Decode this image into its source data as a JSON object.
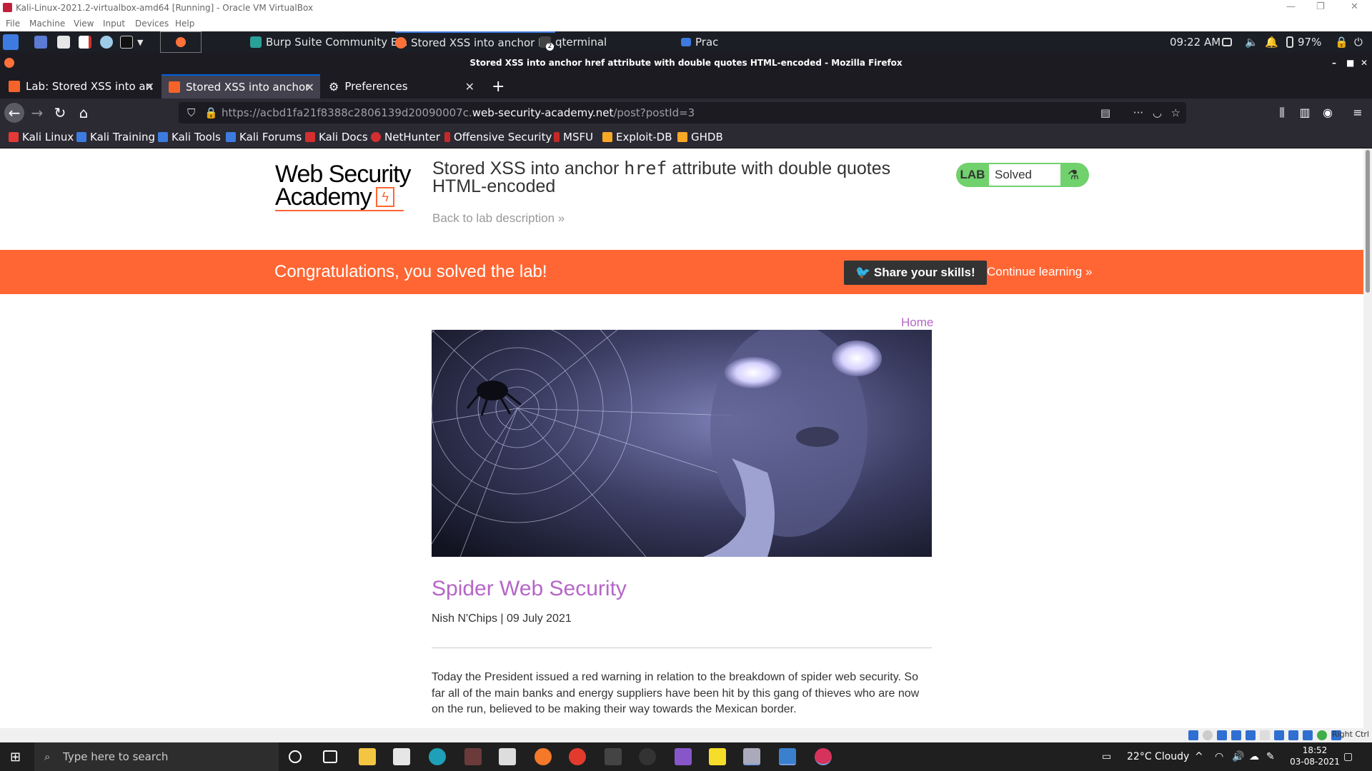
{
  "vbox": {
    "title": "Kali-Linux-2021.2-virtualbox-amd64 [Running] - Oracle VM VirtualBox",
    "menu": [
      "File",
      "Machine",
      "View",
      "Input",
      "Devices",
      "Help"
    ],
    "status_right": "Right Ctrl"
  },
  "kali_panel": {
    "tasks": [
      {
        "label": "Burp Suite Community E...",
        "color": "#2aa198"
      },
      {
        "label": "Stored XSS into anchor h...",
        "color": "#ff7139"
      },
      {
        "label": "qterminal",
        "color": "#888888"
      },
      {
        "label": "Prac",
        "color": "#3d7be0"
      }
    ],
    "terminal_badge": "2",
    "time": "09:22 AM",
    "battery": "97%"
  },
  "firefox": {
    "window_title": "Stored XSS into anchor href attribute with double quotes HTML-encoded - Mozilla Firefox",
    "tabs": [
      {
        "label": "Lab: Stored XSS into anchor",
        "active": false
      },
      {
        "label": "Stored XSS into anchor hr",
        "active": true
      },
      {
        "label": "Preferences",
        "active": false
      }
    ],
    "url_prefix": "https://acbd1fa21f8388c2806139d20090007c.",
    "url_domain": "web-security-academy.net",
    "url_path": "/post?postId=3",
    "bookmarks": [
      {
        "label": "Kali Linux",
        "color": "#e53935"
      },
      {
        "label": "Kali Training",
        "color": "#3d7be0"
      },
      {
        "label": "Kali Tools",
        "color": "#3d7be0"
      },
      {
        "label": "Kali Forums",
        "color": "#3d7be0"
      },
      {
        "label": "Kali Docs",
        "color": "#d32f2f"
      },
      {
        "label": "NetHunter",
        "color": "#d32f2f"
      },
      {
        "label": "Offensive Security",
        "color": "#c62828"
      },
      {
        "label": "MSFU",
        "color": "#c62828"
      },
      {
        "label": "Exploit-DB",
        "color": "#f9a825"
      },
      {
        "label": "GHDB",
        "color": "#f9a825"
      }
    ]
  },
  "page": {
    "logo_line1": "Web Security",
    "logo_line2": "Academy",
    "lab_title_part1": "Stored XSS into anchor ",
    "lab_title_code": "href",
    "lab_title_part2": " attribute with double quotes HTML-encoded",
    "back_link": "Back to lab description »",
    "lab_badge_label": "LAB",
    "lab_status": "Solved",
    "banner_message": "Congratulations, you solved the lab!",
    "share_button": "Share your skills!",
    "continue_link": "Continue learning »",
    "home_link": "Home",
    "post_title": "Spider Web Security",
    "post_meta": "Nish N'Chips | 09 July 2021",
    "post_body": "Today the President issued a red warning in relation to the breakdown of spider web security. So far all of the main banks and energy suppliers have been hit by this gang of thieves who are now on the run, believed to be making their way towards the Mexican border."
  },
  "taskbar": {
    "search_placeholder": "Type here to search",
    "weather": "22°C  Cloudy",
    "time": "18:52",
    "date": "03-08-2021"
  }
}
